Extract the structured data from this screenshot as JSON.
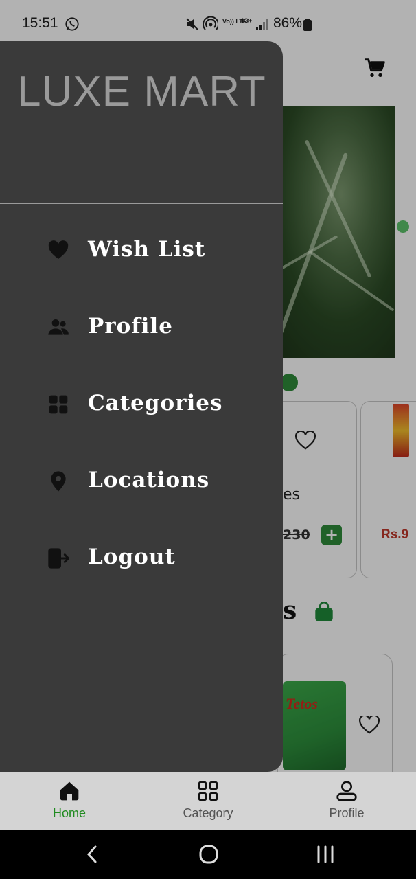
{
  "status_bar": {
    "time": "15:51",
    "volte_label": "Vo)) LTE1",
    "network_label": "4G+",
    "battery": "86%"
  },
  "app": {
    "product_name_fragment": "es",
    "product_price_fragment": "230",
    "price2_fragment": "Rs.9",
    "section_fragment": "s",
    "snack_brand": "Tetos",
    "add_label": "+"
  },
  "drawer": {
    "title": "LUXE MART",
    "items": [
      {
        "label": "Wish List",
        "icon": "heart-icon"
      },
      {
        "label": "Profile",
        "icon": "people-icon"
      },
      {
        "label": "Categories",
        "icon": "grid-icon"
      },
      {
        "label": "Locations",
        "icon": "location-pin-icon"
      },
      {
        "label": "Logout",
        "icon": "logout-icon"
      }
    ]
  },
  "bottom_nav": {
    "items": [
      {
        "label": "Home",
        "icon": "home-icon",
        "active": true
      },
      {
        "label": "Category",
        "icon": "grid-outline-icon",
        "active": false
      },
      {
        "label": "Profile",
        "icon": "person-icon",
        "active": false
      }
    ]
  },
  "colors": {
    "drawer_bg": "#3a3a3a",
    "drawer_title": "#9a9a9a",
    "accent_green": "#1f8a1f",
    "nav_bg": "#d4d4d4"
  }
}
